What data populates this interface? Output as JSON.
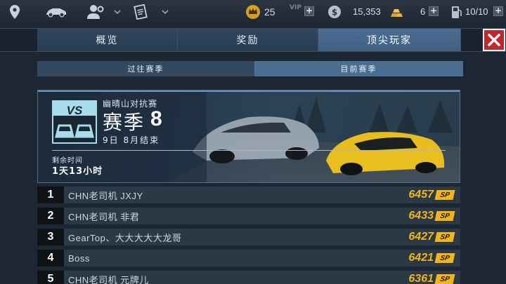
{
  "topbar": {
    "icons": [
      "map-pin-icon",
      "car-icon",
      "profile-settings-icon",
      "chevron-down-icon",
      "notes-icon",
      "chevron-down-icon"
    ],
    "crown_count": "25",
    "vip_label": "VIP",
    "coins": "15,353",
    "gold": "6",
    "fuel": "10/10"
  },
  "tabs": [
    {
      "label": "概览",
      "active": false
    },
    {
      "label": "奖励",
      "active": false
    },
    {
      "label": "顶尖玩家",
      "active": true
    }
  ],
  "subtabs": [
    {
      "label": "过往赛季",
      "active": false
    },
    {
      "label": "目前赛季",
      "active": true
    }
  ],
  "season": {
    "subtitle": "幽晴山对抗赛",
    "title": "赛季",
    "number": "8",
    "end_date": "9日 8月结束",
    "remain_label": "剩余时间",
    "remain_value": "1天13小时",
    "badge_text": "VS"
  },
  "leaderboard": [
    {
      "rank": "1",
      "name": "CHN老司机 JXJY",
      "score": "6457",
      "unit": "SP"
    },
    {
      "rank": "2",
      "name": "CHN老司机 非君",
      "score": "6433",
      "unit": "SP"
    },
    {
      "rank": "3",
      "name": "GearTop、大大大大大龙哥",
      "score": "6427",
      "unit": "SP"
    },
    {
      "rank": "4",
      "name": "Boss",
      "score": "6421",
      "unit": "SP"
    },
    {
      "rank": "5",
      "name": "CHN老司机 元牌儿",
      "score": "6361",
      "unit": "SP"
    }
  ],
  "colors": {
    "accent_gold": "#f2b519",
    "close_red": "#c1272d",
    "active_tab": "#4c6e93"
  }
}
